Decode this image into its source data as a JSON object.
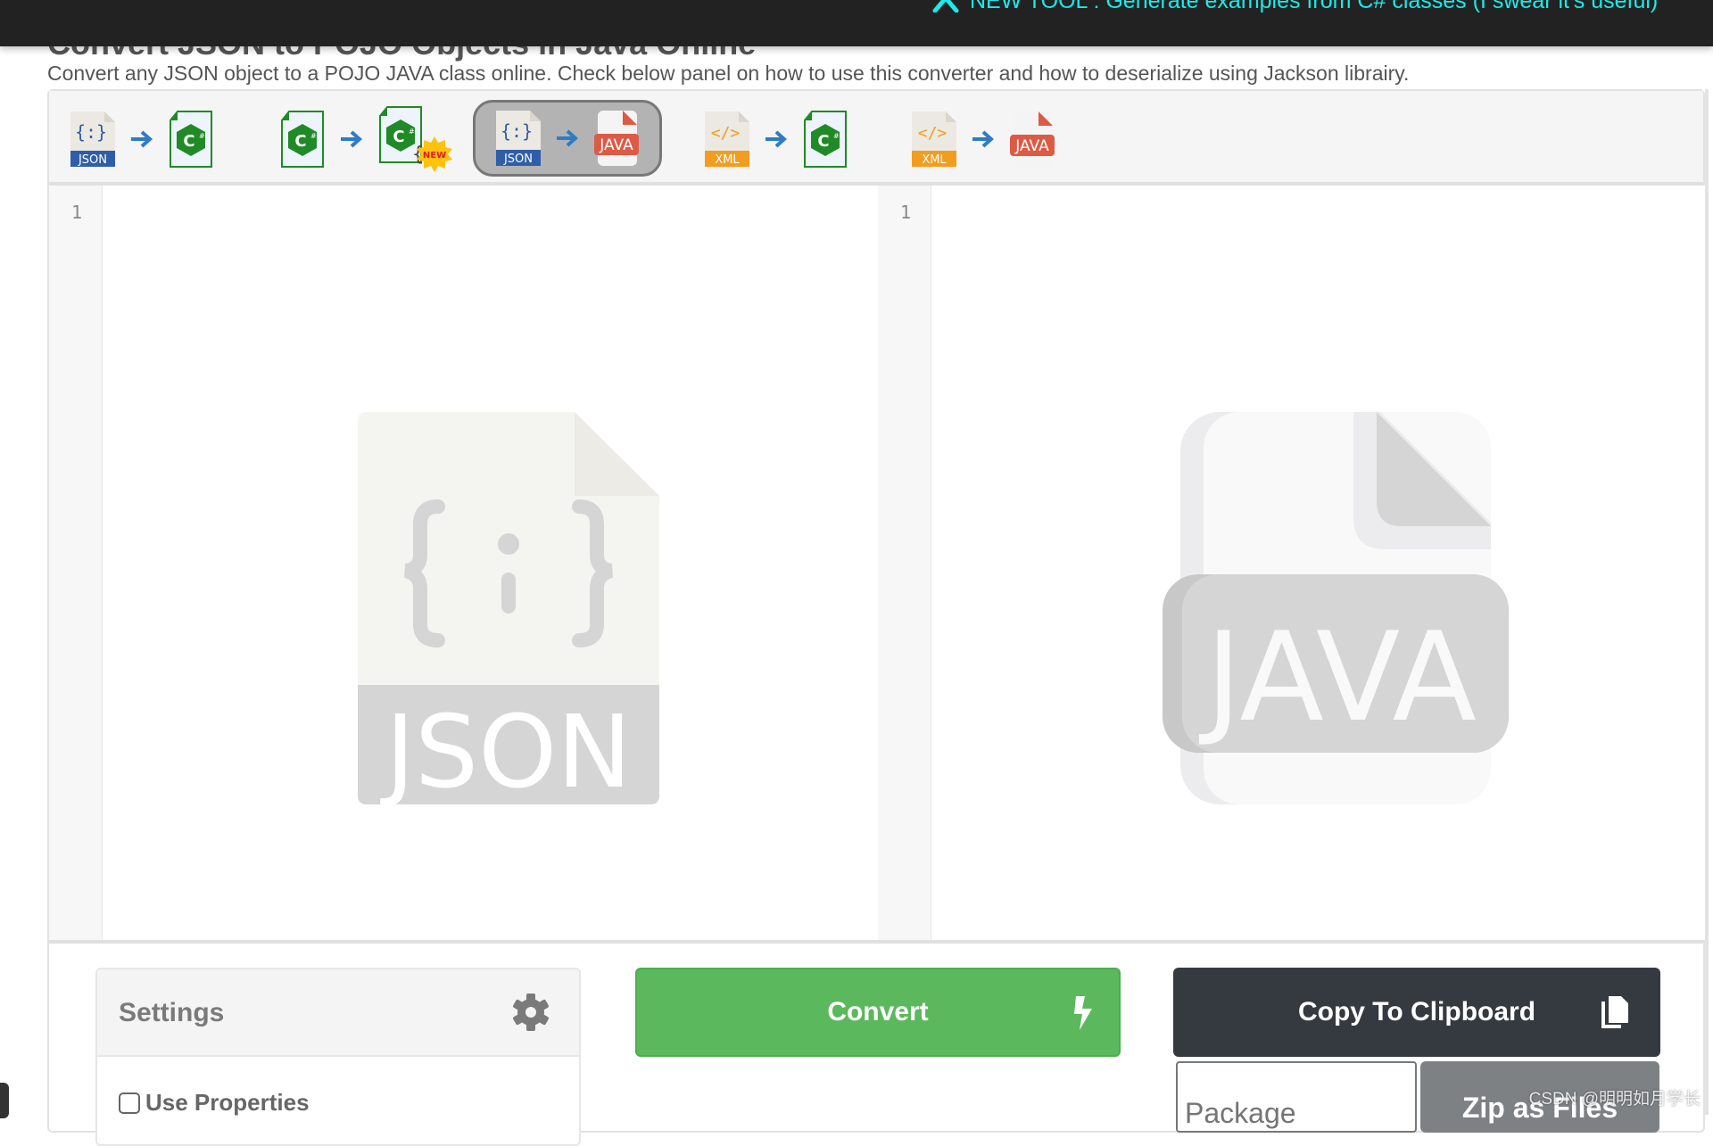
{
  "announcement": {
    "icon": "tools-icon",
    "text": "NEW TOOL : Generate examples from C# classes (I swear it's useful)"
  },
  "header": {
    "title": "Convert JSON to POJO Objects in Java Online",
    "subtitle": "Convert any JSON object to a POJO JAVA class online. Check below panel on how to use this converter and how to deserialize using Jackson librairy."
  },
  "toolbar": {
    "converters": [
      {
        "from": "JSON",
        "to": "C#",
        "active": false,
        "badge": ""
      },
      {
        "from": "C#",
        "to": "C# examples",
        "active": false,
        "badge": "NEW"
      },
      {
        "from": "JSON",
        "to": "JAVA",
        "active": true,
        "badge": ""
      },
      {
        "from": "XML",
        "to": "C#",
        "active": false,
        "badge": ""
      },
      {
        "from": "XML",
        "to": "JAVA",
        "active": false,
        "badge": ""
      }
    ],
    "labels": {
      "json": "JSON",
      "xml": "XML",
      "java": "JAVA",
      "new": "NEW"
    }
  },
  "editors": {
    "left": {
      "line_number": "1",
      "placeholder_label": "JSON"
    },
    "right": {
      "line_number": "1",
      "placeholder_label": "JAVA"
    }
  },
  "settings": {
    "title": "Settings",
    "options": [
      {
        "label": "Use Properties",
        "checked": false
      }
    ]
  },
  "actions": {
    "convert_label": "Convert",
    "copy_label": "Copy To Clipboard",
    "package_placeholder": "Package",
    "package_value": "",
    "zip_label": "Zip as Files"
  },
  "watermark": "CSDN @明明如月学长",
  "colors": {
    "topbar": "#222222",
    "announce": "#1de9e9",
    "convert": "#5cb85c",
    "copy": "#353a40",
    "zip": "#7d8184",
    "json_blue": "#2f5ea8",
    "xml_orange": "#f29d1f",
    "java_red": "#dd5a45",
    "csharp_green": "#1f8a26"
  }
}
